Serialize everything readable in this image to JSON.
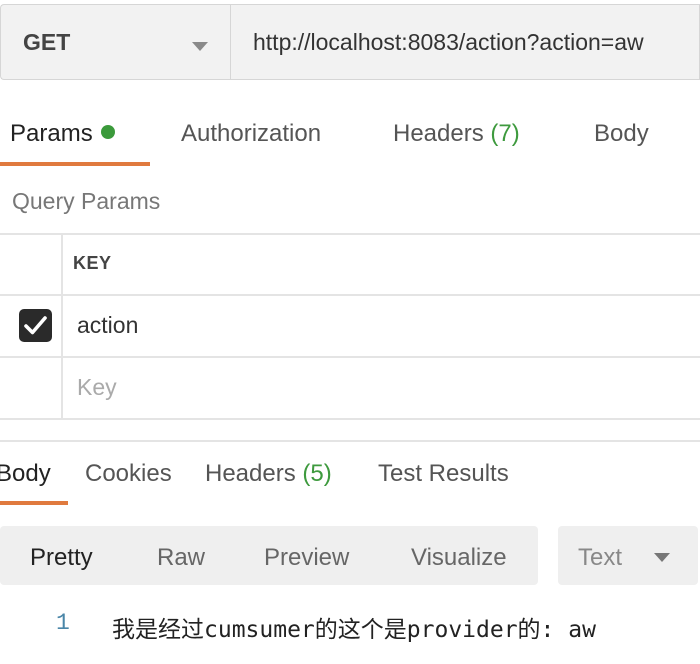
{
  "request": {
    "method": "GET",
    "url": "http://localhost:8083/action?action=aw"
  },
  "request_tabs": {
    "params": "Params",
    "authorization": "Authorization",
    "headers_label": "Headers",
    "headers_count": "(7)",
    "body": "Body"
  },
  "query_params": {
    "title": "Query Params",
    "key_header": "KEY",
    "rows": [
      {
        "checked": true,
        "key": "action"
      }
    ],
    "new_key_placeholder": "Key"
  },
  "response_tabs": {
    "body": "Body",
    "cookies": "Cookies",
    "headers_label": "Headers",
    "headers_count": "(5)",
    "test_results": "Test Results"
  },
  "format": {
    "options": [
      "Pretty",
      "Raw",
      "Preview",
      "Visualize"
    ],
    "active": "Pretty",
    "language": "Text"
  },
  "response_body": {
    "lines": [
      {
        "number": "1",
        "text": "我是经过cumsumer的这个是provider的: aw"
      }
    ]
  },
  "colors": {
    "accent_underline": "#e07a3e",
    "status_green": "#3b9a3b",
    "line_number": "#4a86a8"
  },
  "icons": [
    "chevron-down-icon",
    "status-dot-icon",
    "checkmark-icon"
  ]
}
